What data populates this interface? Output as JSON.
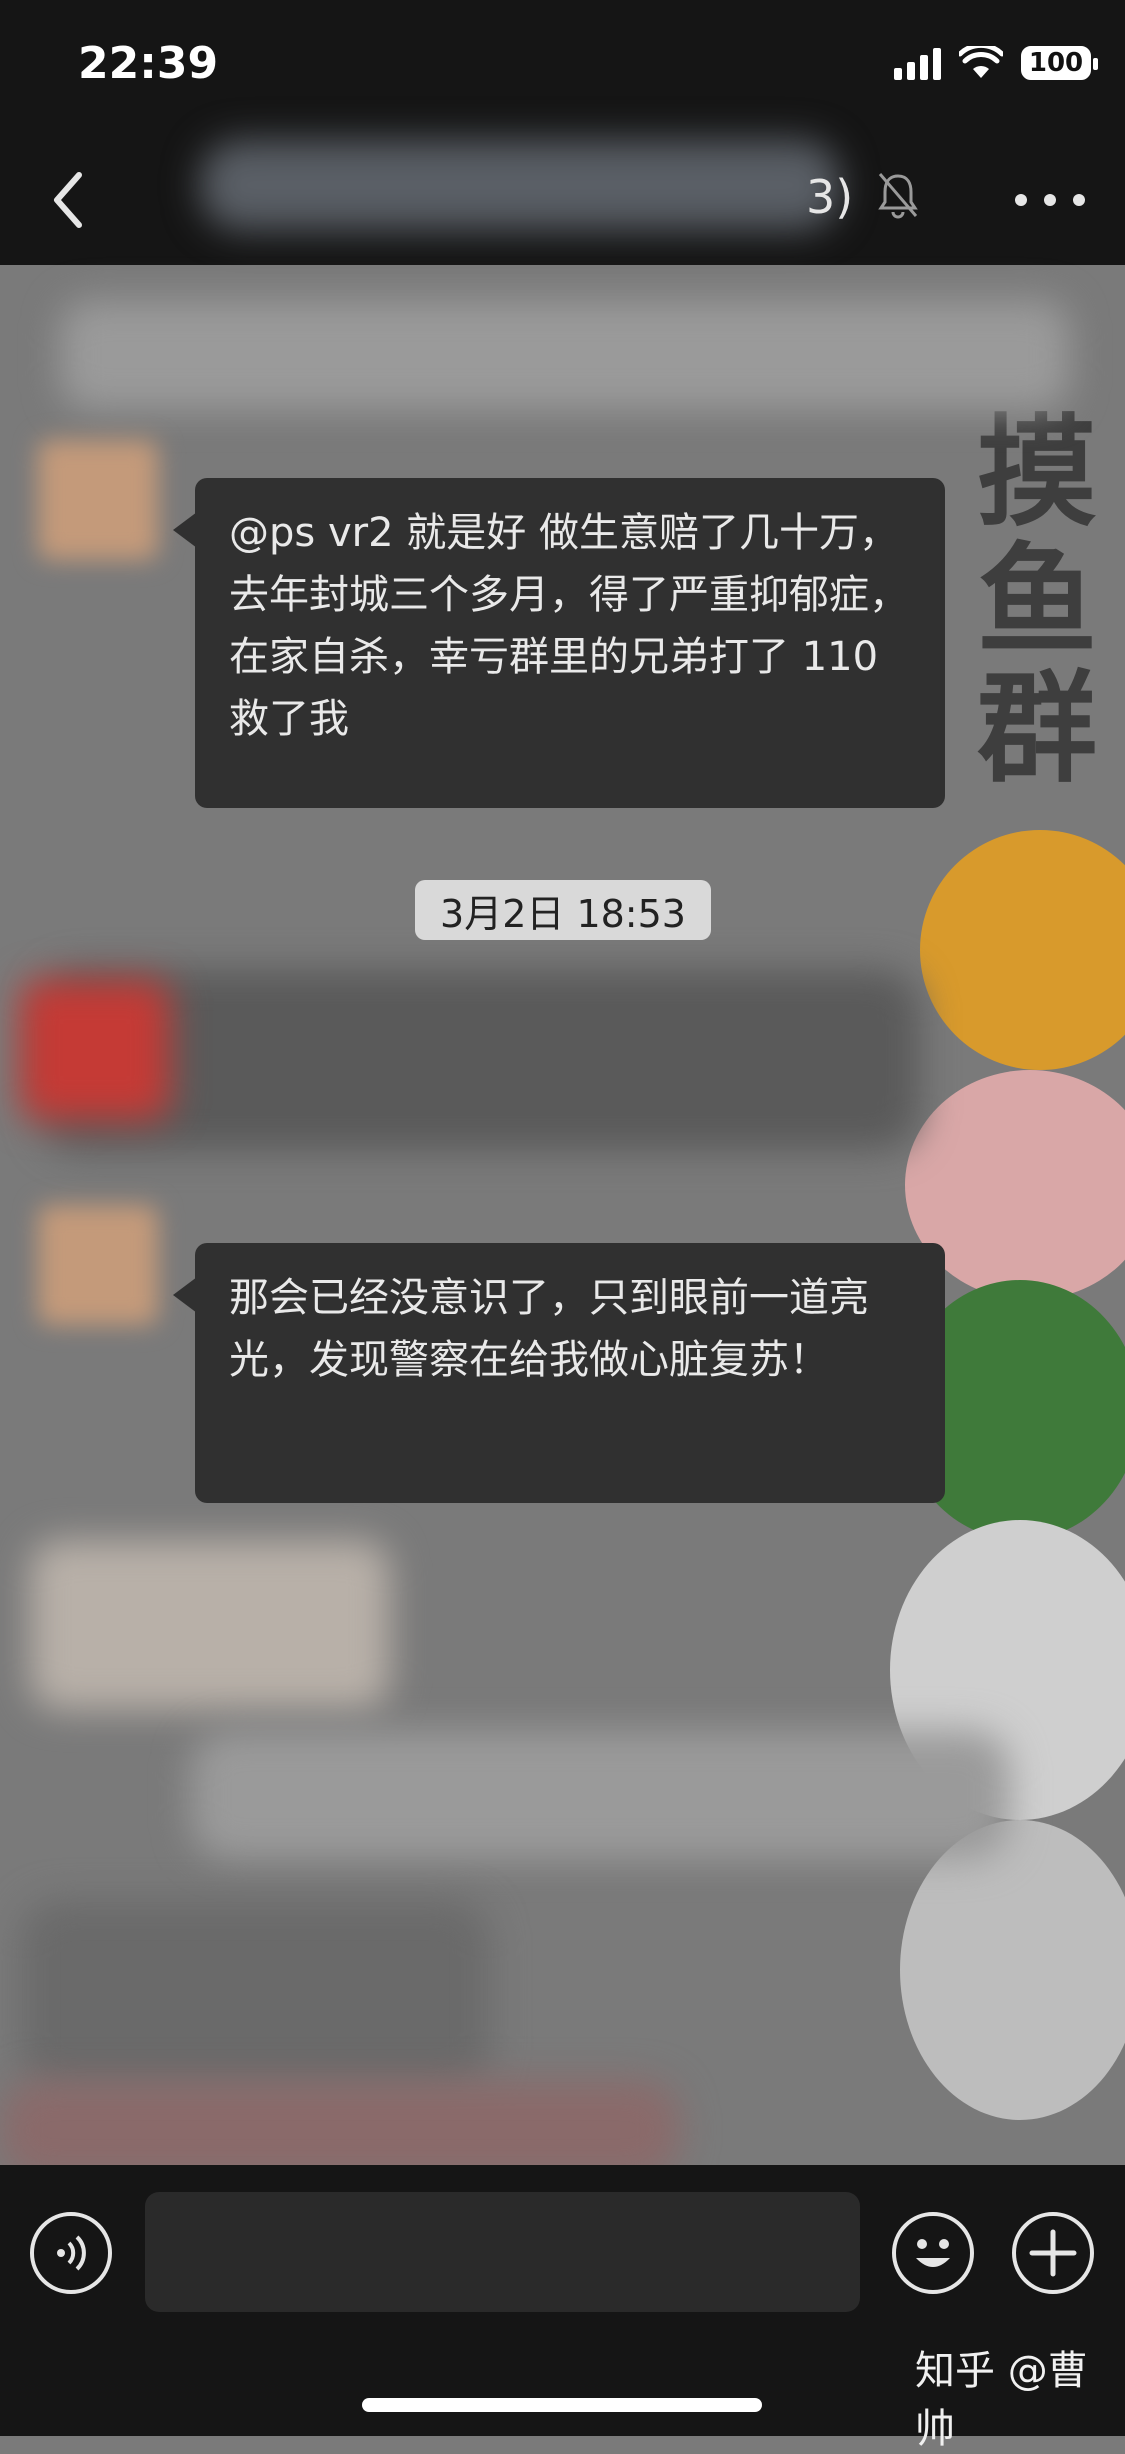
{
  "status_bar": {
    "time": "22:39",
    "battery": "100"
  },
  "nav": {
    "member_count_suffix": "3)"
  },
  "wallpaper": {
    "text": "摸鱼群"
  },
  "messages": [
    {
      "text": "@ps vr2 就是好 做生意赔了几十万，去年封城三个多月，得了严重抑郁症，在家自杀，幸亏群里的兄弟打了 110 救了我"
    },
    {
      "text": "那会已经没意识了，只到眼前一道亮光，发现警察在给我做心脏复苏！"
    }
  ],
  "timestamp": "3月2日 18:53",
  "watermark": "知乎 @曹帅",
  "colors": {
    "top_bar": "#151515",
    "chat_bg": "#7a7a7a",
    "bubble": "#303030"
  }
}
